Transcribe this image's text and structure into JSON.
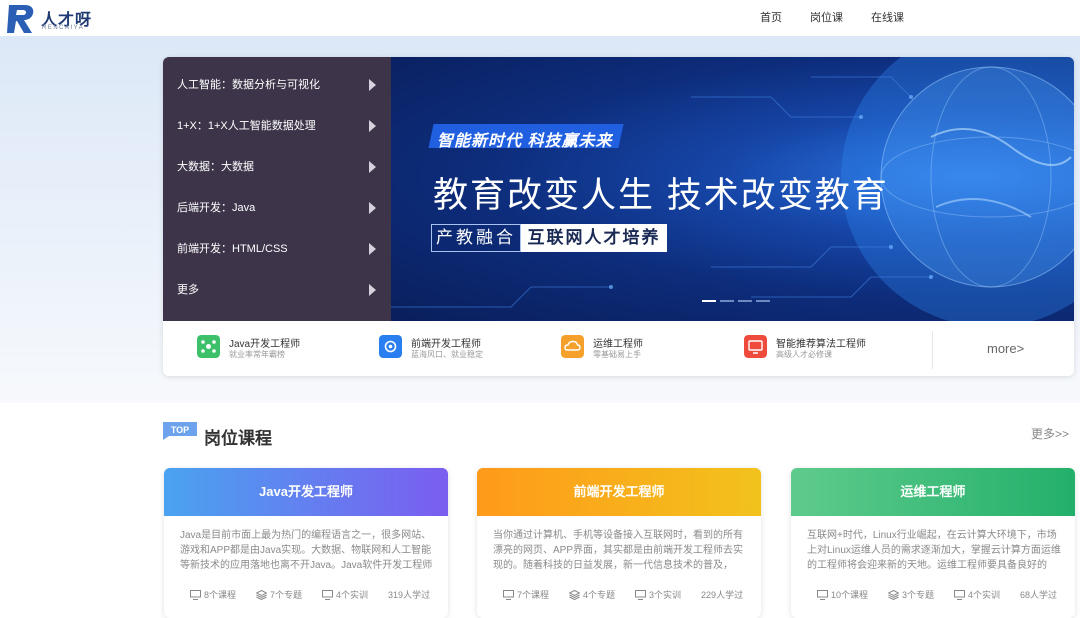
{
  "header": {
    "logo_text": "人才呀",
    "logo_sub": "RENCAIYA",
    "nav": [
      "首页",
      "岗位课",
      "在线课"
    ]
  },
  "side_menu": [
    "人工智能：数据分析与可视化",
    "1+X：1+X人工智能数据处理",
    "大数据：大数据",
    "后端开发：Java",
    "前端开发：HTML/CSS",
    "更多"
  ],
  "banner": {
    "tag": "智能新时代  科技赢未来",
    "title": "教育改变人生  技术改变教育",
    "sub1": "产教融合",
    "sub2": "互联网人才培养"
  },
  "job_links": [
    {
      "title": "Java开发工程师",
      "desc": "就业率常年霸榜",
      "color": "#3cc16a"
    },
    {
      "title": "前端开发工程师",
      "desc": "蓝海风口、就业稳定",
      "color": "#2a7ff0"
    },
    {
      "title": "运维工程师",
      "desc": "零基础易上手",
      "color": "#f5a02a"
    },
    {
      "title": "智能推荐算法工程师",
      "desc": "高级人才必修课",
      "color": "#ee4b3c"
    }
  ],
  "strip_more": "more>",
  "section": {
    "badge": "TOP",
    "title": "岗位课程",
    "more": "更多>>"
  },
  "courses": [
    {
      "title": "Java开发工程师",
      "desc": "Java是目前市面上最为热门的编程语言之一，很多网站、游戏和APP都是由Java实现。大数据、物联网和人工智能等新技术的应用落地也离不开Java。Java软件开发工程师要...",
      "courses": "8个课程",
      "topics": "7个专题",
      "labs": "4个实训",
      "learners": "319人学过"
    },
    {
      "title": "前端开发工程师",
      "desc": "当你通过计算机、手机等设备接入互联网时，看到的所有漂亮的网页、APP界面，其实都是由前端开发工程师去实现的。随着科技的日益发展，新一代信息技术的普及，Web...",
      "courses": "7个课程",
      "topics": "4个专题",
      "labs": "3个实训",
      "learners": "229人学过"
    },
    {
      "title": "运维工程师",
      "desc": "互联网+时代，Linux行业崛起，在云计算大环境下，市场上对Linux运维人员的需求逐渐加大，掌握云计算方面运维的工程师将会迎来新的天地。运维工程师要具备良好的沟...",
      "courses": "10个课程",
      "topics": "3个专题",
      "labs": "4个实训",
      "learners": "68人学过"
    }
  ]
}
